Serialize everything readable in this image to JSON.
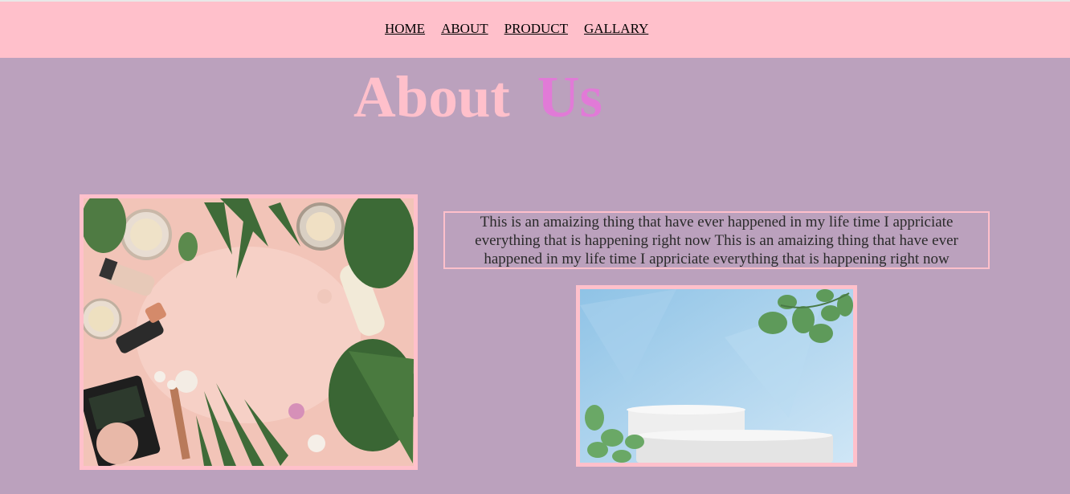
{
  "nav": {
    "items": [
      {
        "label": "HOME"
      },
      {
        "label": "ABOUT"
      },
      {
        "label": "PRODUCT"
      },
      {
        "label": "GALLARY"
      }
    ]
  },
  "heading": {
    "word1": "About",
    "word2": "Us"
  },
  "about_text": "This is an amaizing thing that have ever happened in my life time I appriciate everything that is happening right now This is an amaizing thing that have ever happened in my life time I appriciate everything that is happening right now",
  "images": {
    "left": {
      "subject": "cosmetics-flatlay-image"
    },
    "right": {
      "subject": "podium-leaves-image"
    }
  },
  "colors": {
    "background": "#bba1bd",
    "navbar": "#ffc0cb",
    "heading_word1": "#ffc0cb",
    "heading_word2": "#e17ad7",
    "border": "#ffc0cb"
  }
}
